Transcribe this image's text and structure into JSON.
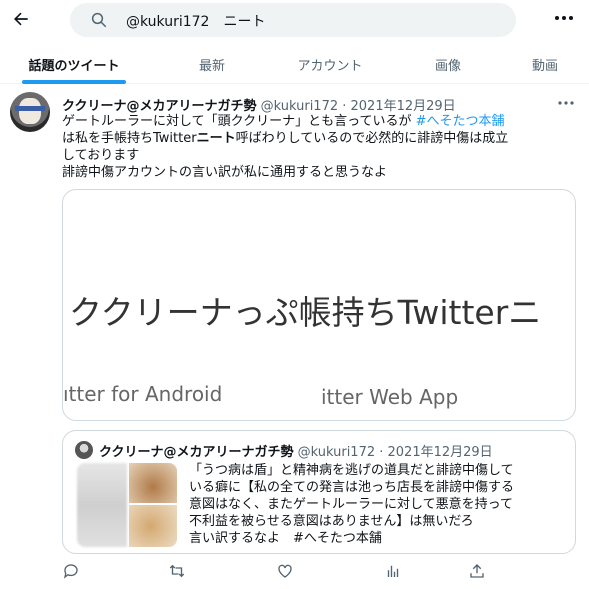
{
  "search": {
    "query": "@kukuri172　ニート"
  },
  "icons": {
    "back": "back-arrow-icon",
    "search": "search-icon",
    "more": "more-icon",
    "reply": "reply-icon",
    "retweet": "retweet-icon",
    "like": "like-icon",
    "views": "views-icon",
    "share": "share-icon"
  },
  "colors": {
    "accent": "#1d9bf0",
    "text": "#0f1419",
    "secondary": "#536471",
    "border": "#cfd9de"
  },
  "tabs": [
    {
      "label": "話題のツイート",
      "active": true
    },
    {
      "label": "最新",
      "active": false
    },
    {
      "label": "アカウント",
      "active": false
    },
    {
      "label": "画像",
      "active": false
    },
    {
      "label": "動画",
      "active": false
    }
  ],
  "tweet": {
    "name": "ククリーナ@メカアリーナガチ勢",
    "meta": " @kukuri172 · 2021年12月29日",
    "line1_a": "ゲートルーラーに対して「頭ククリーナ」とも言っているが ",
    "line1_hashtag": "#へそたつ本舗",
    "line2_a": "は私を手帳持ちTwitter",
    "line2_bold": "ニート",
    "line2_b": "呼ばわりしているので必然的に誹謗中傷は成立",
    "line3": "しております",
    "line4": "誹謗中傷アカウントの言い訳が私に通用すると思うなよ"
  },
  "media": {
    "big_text": "ククリーナっぷ帳持ちTwitterニ",
    "small1": "ıtter for Android",
    "small2": "itter Web App"
  },
  "quote": {
    "name": "ククリーナ@メカアリーナガチ勢",
    "meta": " @kukuri172 · 2021年12月29日",
    "lines": [
      "「うつ病は盾」と精神病を逃げの道具だと誹謗中傷して",
      "いる癖に【私の全ての発言は池っち店長を誹謗中傷する",
      "意図はなく、またゲートルーラーに対して悪意を持って",
      "不利益を被らせる意図はありません】は無いだろ",
      "言い訳するなよ　#へそたつ本舗"
    ]
  }
}
